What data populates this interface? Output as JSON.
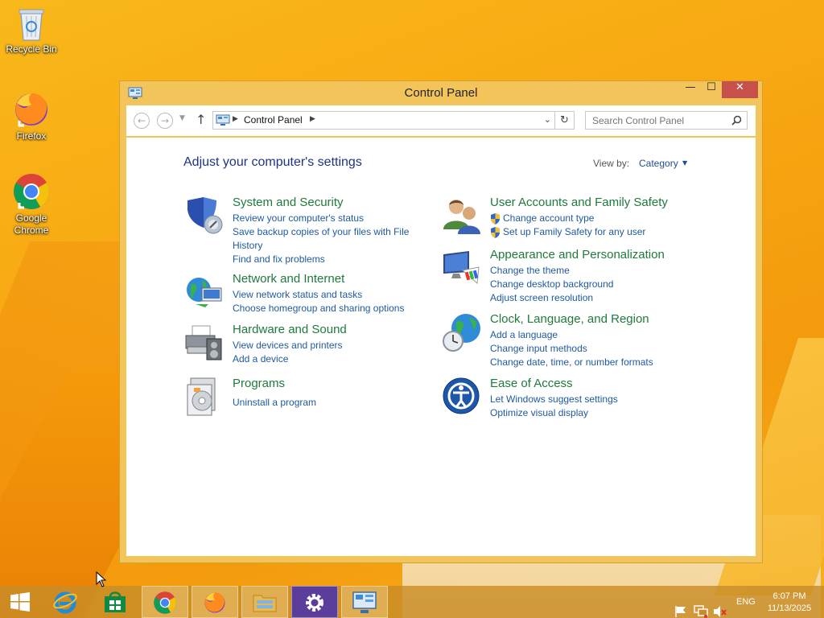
{
  "desktop": {
    "icons": [
      {
        "label": "Recycle Bin"
      },
      {
        "label": "Firefox"
      },
      {
        "label": "Google Chrome"
      }
    ]
  },
  "window": {
    "title": "Control Panel",
    "controls": {
      "minimize": "—",
      "maximize": "☐",
      "close": "✕"
    }
  },
  "address_bar": {
    "path": "Control Panel",
    "search_placeholder": "Search Control Panel"
  },
  "content": {
    "heading": "Adjust your computer's settings",
    "view_by_label": "View by:",
    "view_by_value": "Category",
    "categories_left": [
      {
        "title": "System and Security",
        "links": [
          "Review your computer's status",
          "Save backup copies of your files with File History",
          "Find and fix problems"
        ]
      },
      {
        "title": "Network and Internet",
        "links": [
          "View network status and tasks",
          "Choose homegroup and sharing options"
        ]
      },
      {
        "title": "Hardware and Sound",
        "links": [
          "View devices and printers",
          "Add a device"
        ]
      },
      {
        "title": "Programs",
        "links": [
          "Uninstall a program"
        ]
      }
    ],
    "categories_right": [
      {
        "title": "User Accounts and Family Safety",
        "links": [
          "Change account type",
          "Set up Family Safety for any user"
        ]
      },
      {
        "title": "Appearance and Personalization",
        "links": [
          "Change the theme",
          "Change desktop background",
          "Adjust screen resolution"
        ]
      },
      {
        "title": "Clock, Language, and Region",
        "links": [
          "Add a language",
          "Change input methods",
          "Change date, time, or number formats"
        ]
      },
      {
        "title": "Ease of Access",
        "links": [
          "Let Windows suggest settings",
          "Optimize visual display"
        ]
      }
    ]
  },
  "taskbar": {
    "language": "ENG",
    "time": "6:07 PM",
    "date": "11/13/2025"
  }
}
